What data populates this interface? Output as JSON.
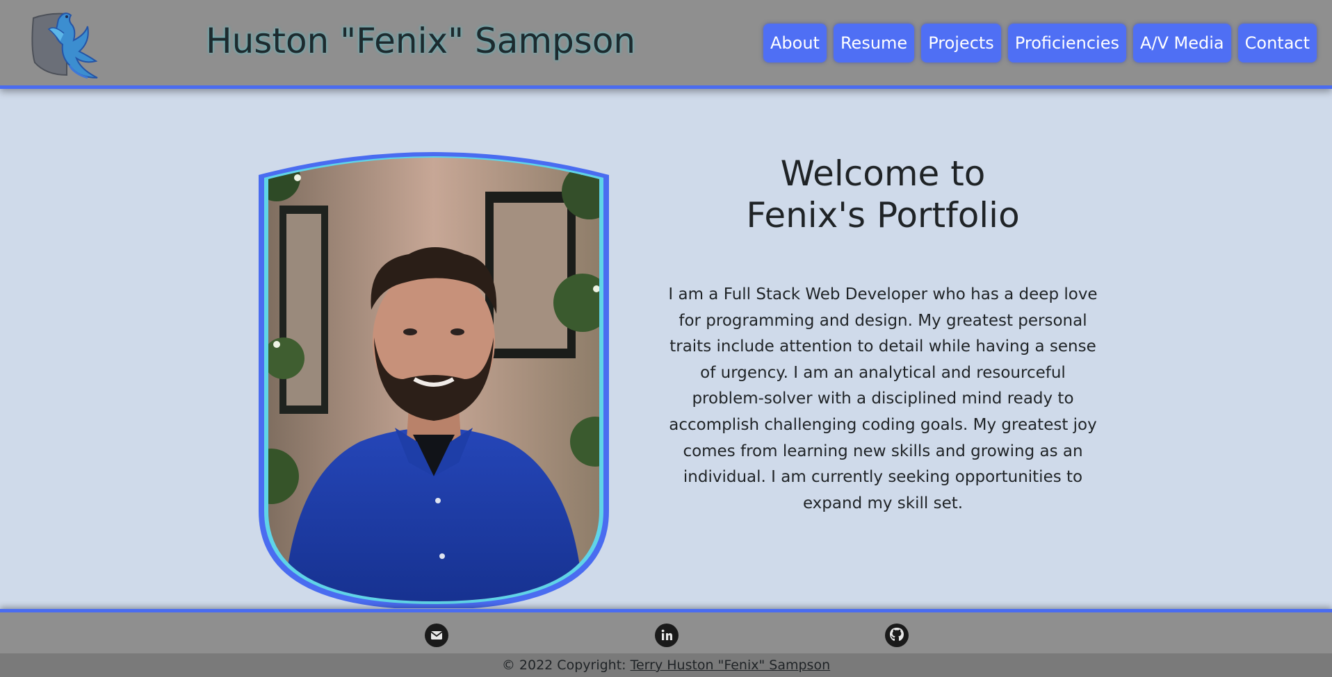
{
  "header": {
    "site_title": "Huston \"Fenix\" Sampson",
    "logo_icon": "phoenix-shield-icon",
    "nav": [
      {
        "label": "About"
      },
      {
        "label": "Resume"
      },
      {
        "label": "Projects"
      },
      {
        "label": "Proficiencies"
      },
      {
        "label": "A/V Media"
      },
      {
        "label": "Contact"
      }
    ]
  },
  "hero": {
    "title_line1": "Welcome to",
    "title_line2": "Fenix's Portfolio",
    "body": "I am a Full Stack Web Developer who has a deep love for programming and design. My greatest personal traits include attention to detail while having a sense of urgency. I am an analytical and resourceful problem-solver with a disciplined mind ready to accomplish challenging coding goals. My greatest joy comes from learning new skills and growing as an individual. I am currently seeking opportunities to expand my skill set."
  },
  "footer": {
    "social": [
      {
        "icon": "email-icon"
      },
      {
        "icon": "linkedin-icon"
      },
      {
        "icon": "github-icon"
      }
    ],
    "copyright_prefix": "© 2022 Copyright: ",
    "copyright_link": "Terry Huston \"Fenix\" Sampson"
  },
  "colors": {
    "header_bg": "#8f8f8f",
    "accent_border": "#4a6cf0",
    "nav_button": "#4f6ff4",
    "page_bg": "#cfdaea",
    "portrait_frame_outer": "#4a6cf0",
    "portrait_frame_inner": "#5fd4e8"
  }
}
